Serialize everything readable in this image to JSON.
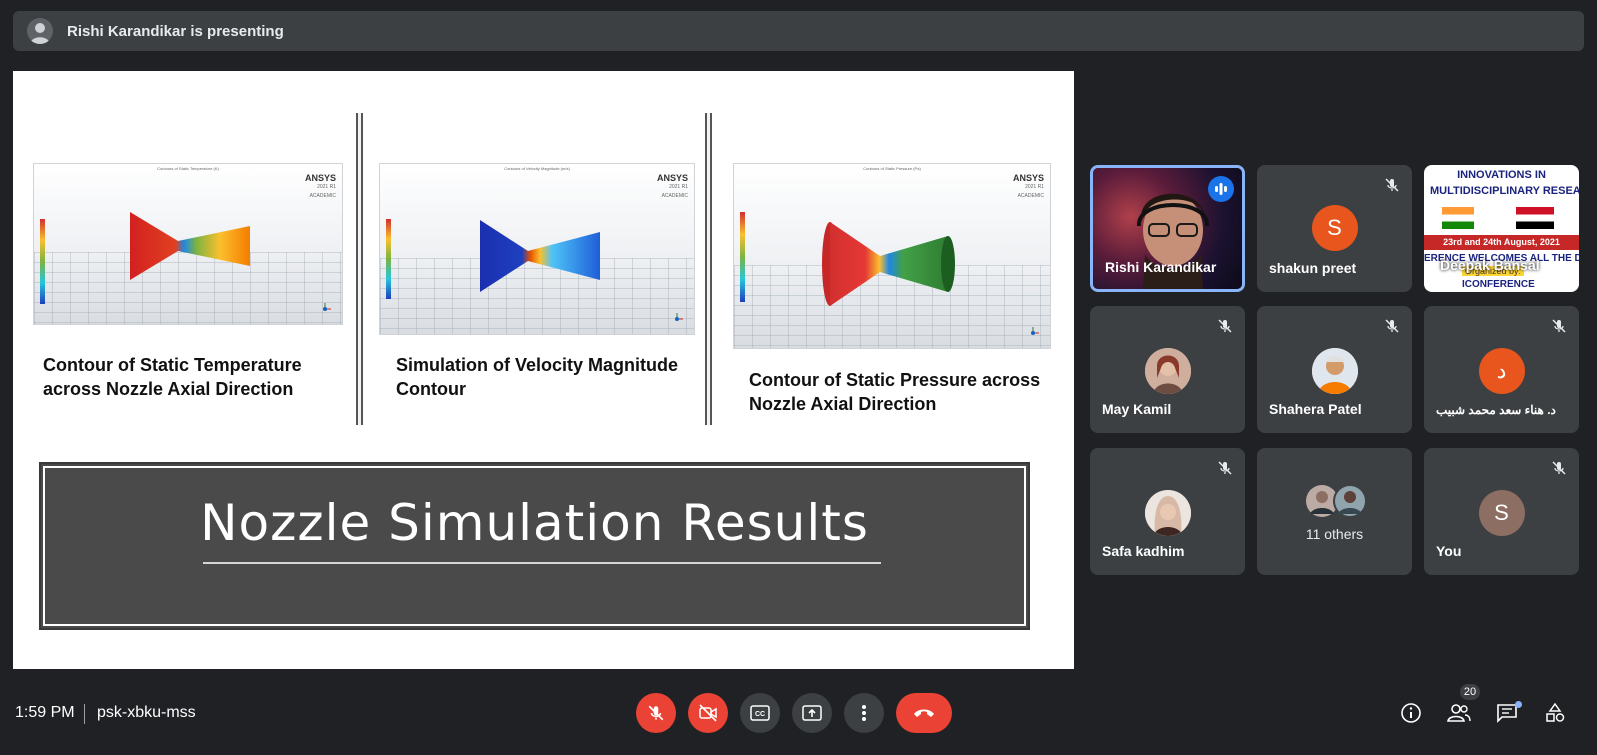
{
  "banner": {
    "text": "Rishi Karandikar is presenting"
  },
  "slide": {
    "panels": [
      {
        "caption_line1": "Contour of Static Temperature",
        "caption_line2": "across Nozzle Axial Direction",
        "logo": "ANSYS",
        "logo_sub": "2021 R1",
        "logo_sub2": "ACADEMIC"
      },
      {
        "caption_line1": "Simulation of Velocity Magnitude",
        "caption_line2": "Contour",
        "logo": "ANSYS",
        "logo_sub": "2021 R1",
        "logo_sub2": "ACADEMIC"
      },
      {
        "caption_line1": "Contour of Static Pressure across",
        "caption_line2": "Nozzle Axial Direction",
        "logo": "ANSYS",
        "logo_sub": "2021 R1",
        "logo_sub2": "ACADEMIC"
      }
    ],
    "title": "Nozzle Simulation Results"
  },
  "participants": [
    {
      "name": "Rishi Karandikar",
      "type": "video",
      "speaking": true
    },
    {
      "name": "shakun preet",
      "initial": "S",
      "avatar_color": "#e8551d",
      "muted": true
    },
    {
      "name": "Deepak Bansal",
      "type": "poster",
      "muted": true,
      "poster_lines": [
        "INNOVATIONS IN",
        "MULTIDISCIPLINARY RESEA",
        "23rd and 24th August, 2021",
        "ERENCE WELCOMES ALL THE DEL",
        "Organized by:",
        "ICONFERENCE"
      ]
    },
    {
      "name": "May Kamil",
      "muted": true,
      "avatar_color": "#a86a52"
    },
    {
      "name": "Shahera Patel",
      "muted": true,
      "avatar_color": "#d98a3d"
    },
    {
      "name": "د. هناء سعد محمد شبيب",
      "initial": "د",
      "avatar_color": "#e8551d",
      "muted": true
    },
    {
      "name": "Safa kadhim",
      "muted": true,
      "avatar_color": "#c79c85"
    },
    {
      "name": "11 others"
    },
    {
      "name": "You",
      "initial": "S",
      "avatar_color": "#8d6e63",
      "muted": true
    }
  ],
  "bottom": {
    "time": "1:59 PM",
    "meeting_code": "psk-xbku-mss",
    "people_count": "20"
  },
  "colors": {
    "end_call": "#ea4335",
    "background": "#202124",
    "tile": "#3c4043",
    "active_border": "#8ab4f8"
  }
}
